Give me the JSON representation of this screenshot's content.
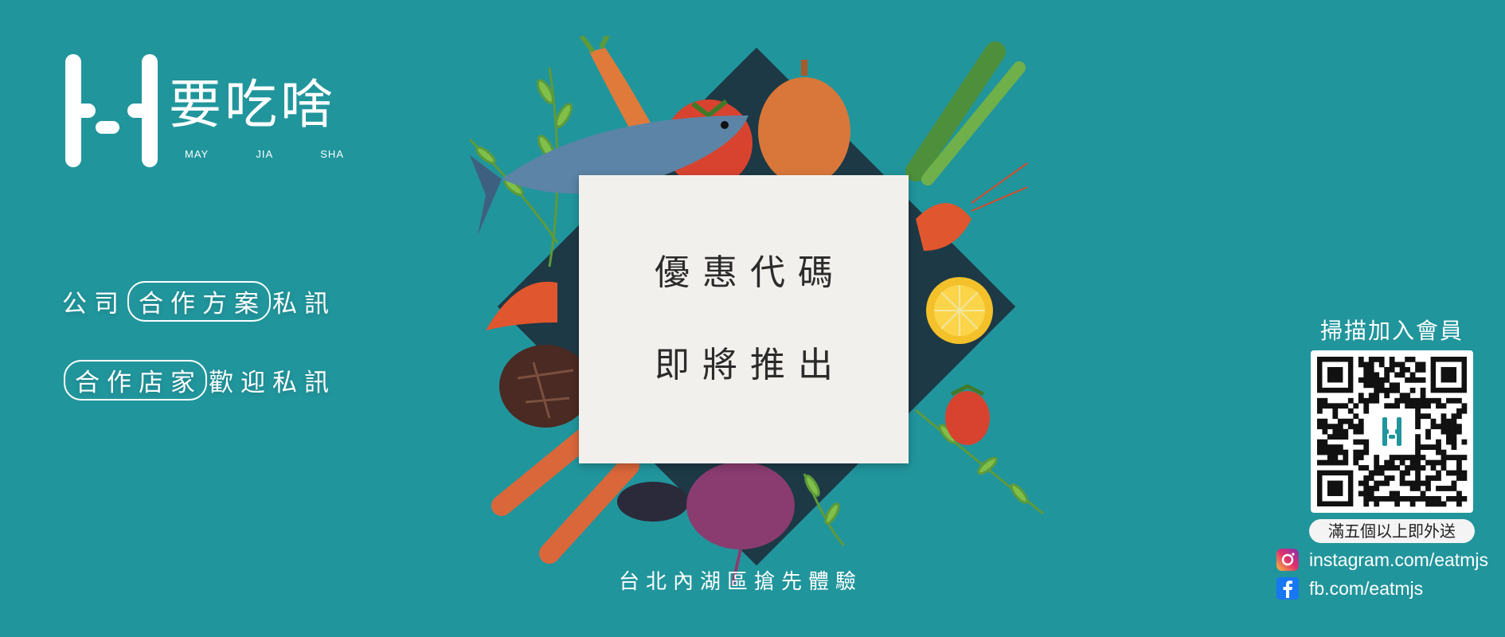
{
  "brand": {
    "name_cn": "要吃啥",
    "roman": [
      "MAY",
      "JIA",
      "SHA"
    ]
  },
  "promo": {
    "line1": {
      "before": "公司",
      "boxed": "合作方案",
      "after": "私訊"
    },
    "line2": {
      "before": "",
      "boxed": "合作店家",
      "after": "歡迎私訊"
    }
  },
  "card": {
    "line1": "優惠代碼",
    "line2": "即將推出"
  },
  "location_text": "台北內湖區搶先體驗",
  "member": {
    "title": "掃描加入會員",
    "badge": "滿五個以上即外送"
  },
  "social": {
    "instagram": "instagram.com/eatmjs",
    "facebook": "fb.com/eatmjs"
  },
  "colors": {
    "background": "#21959c",
    "card": "#f2f0ec",
    "text": "#ffffff",
    "card_text": "#2b2b2b"
  },
  "icons": [
    "instagram-icon",
    "facebook-icon",
    "logo-mark",
    "qr-code"
  ]
}
